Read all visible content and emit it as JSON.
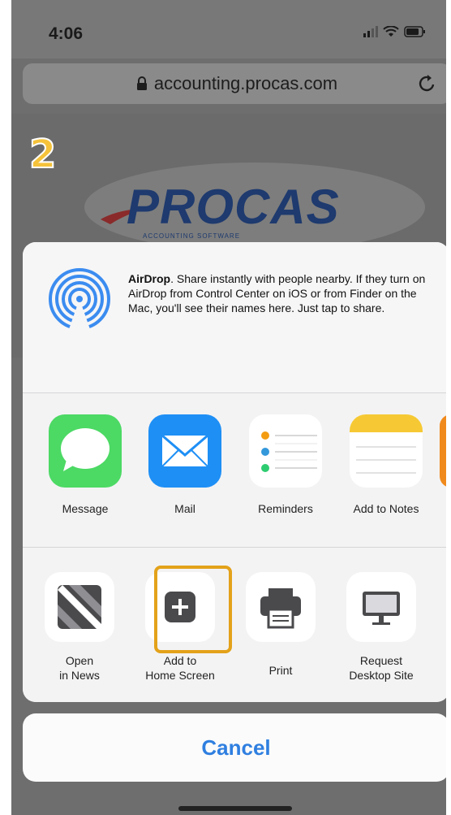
{
  "status_bar": {
    "time": "4:06"
  },
  "browser": {
    "url": "accounting.procas.com"
  },
  "web_page": {
    "step_number": "2",
    "logo_text": "PROCAS",
    "logo_subtitle": "ACCOUNTING SOFTWARE"
  },
  "share_sheet": {
    "airdrop": {
      "title": "AirDrop",
      "description": ". Share instantly with people nearby. If they turn on AirDrop from Control Center on iOS or from Finder on the Mac, you'll see their names here. Just tap to share."
    },
    "apps": [
      {
        "label": "Message",
        "icon": "messages-icon"
      },
      {
        "label": "Mail",
        "icon": "mail-icon"
      },
      {
        "label": "Reminders",
        "icon": "reminders-icon"
      },
      {
        "label": "Add to Notes",
        "icon": "notes-icon"
      }
    ],
    "actions": [
      {
        "line1": "Open",
        "line2": "in News",
        "icon": "news-icon"
      },
      {
        "line1": "Add to",
        "line2": "Home Screen",
        "icon": "add-square-icon"
      },
      {
        "line1": "Print",
        "line2": "",
        "icon": "printer-icon"
      },
      {
        "line1": "Request",
        "line2": "Desktop Site",
        "icon": "desktop-icon"
      }
    ],
    "cancel_label": "Cancel"
  },
  "colors": {
    "accent": "#2f7fe0",
    "highlight": "#e3a21a",
    "messages_green": "#4cd964",
    "mail_blue": "#1e8ff5",
    "notes_yellow": "#f6c934"
  }
}
